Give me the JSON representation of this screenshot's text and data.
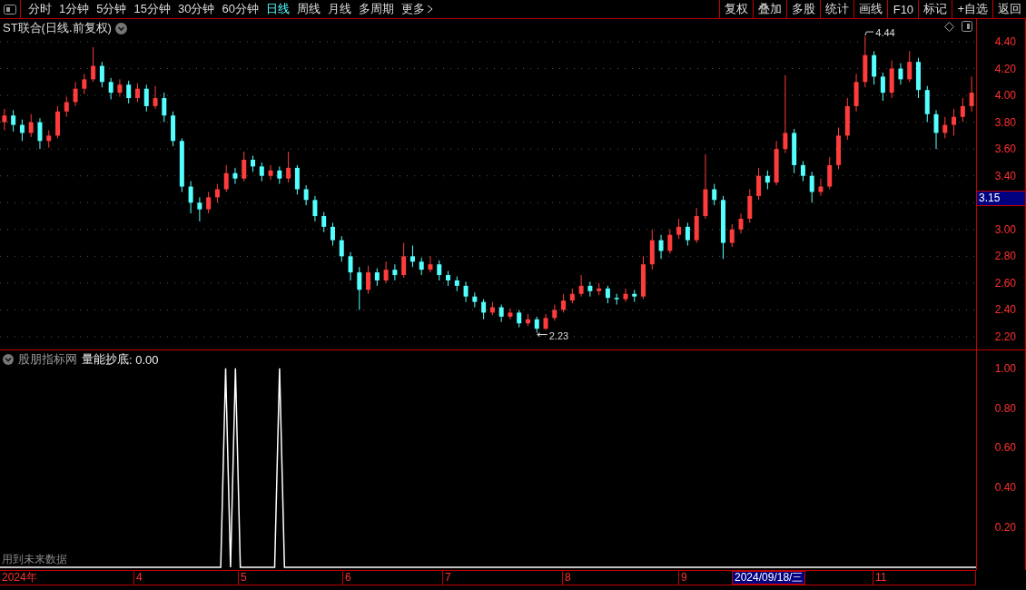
{
  "toolbar": {
    "periods": [
      {
        "label": "分时",
        "selected": false
      },
      {
        "label": "1分钟",
        "selected": false
      },
      {
        "label": "5分钟",
        "selected": false
      },
      {
        "label": "15分钟",
        "selected": false
      },
      {
        "label": "30分钟",
        "selected": false
      },
      {
        "label": "60分钟",
        "selected": false
      },
      {
        "label": "日线",
        "selected": true
      },
      {
        "label": "周线",
        "selected": false
      },
      {
        "label": "月线",
        "selected": false
      },
      {
        "label": "多周期",
        "selected": false
      },
      {
        "label": "更多",
        "selected": false
      }
    ],
    "buttons": [
      "复权",
      "叠加",
      "多股",
      "统计",
      "画线",
      "F10",
      "标记",
      "+自选",
      "返回"
    ]
  },
  "price_chart": {
    "title": "ST联合(日线.前复权)",
    "current_price": "3.15",
    "markers": [
      {
        "kind": "high",
        "label": "4.44"
      },
      {
        "kind": "low",
        "label": "2.23"
      }
    ],
    "chart_data": {
      "type": "candlestick",
      "grid": true,
      "ylim": [
        2.2,
        4.4
      ],
      "yticks": [
        {
          "value": 4.4,
          "label": "4.40"
        },
        {
          "value": 4.2,
          "label": "4.20"
        },
        {
          "value": 4.0,
          "label": "4.00"
        },
        {
          "value": 3.8,
          "label": "3.80"
        },
        {
          "value": 3.6,
          "label": "3.60"
        },
        {
          "value": 3.4,
          "label": "3.40"
        },
        {
          "value": 3.0,
          "label": "3.00"
        },
        {
          "value": 2.8,
          "label": "2.80"
        },
        {
          "value": 2.6,
          "label": "2.60"
        },
        {
          "value": 2.4,
          "label": "2.40"
        },
        {
          "value": 2.2,
          "label": "2.20"
        }
      ],
      "categories": [
        null,
        null,
        null,
        null,
        null,
        null,
        null,
        null,
        null,
        null,
        null,
        null,
        null,
        null,
        null,
        null,
        null,
        null,
        null,
        null,
        null,
        null,
        null,
        null,
        null,
        null,
        null,
        null,
        null,
        null,
        null,
        null,
        null,
        null,
        null,
        null,
        null,
        null,
        null,
        null,
        null,
        null,
        null,
        null,
        null,
        null,
        null,
        null,
        null,
        null,
        null,
        null,
        null,
        null,
        null,
        null,
        null,
        null,
        null,
        null,
        null,
        null,
        null,
        null,
        null,
        null,
        null,
        null,
        null,
        null,
        null,
        null,
        null,
        null,
        null,
        null,
        null,
        null,
        null,
        null,
        null,
        null,
        null,
        null,
        null,
        null,
        null,
        null,
        null,
        null,
        null,
        null,
        null,
        null,
        null,
        null,
        null,
        null,
        null,
        null,
        null,
        null,
        null,
        null,
        null,
        null,
        null,
        null,
        null,
        null
      ],
      "ohlc": [
        [
          3.8,
          3.9,
          3.74,
          3.85
        ],
        [
          3.85,
          3.89,
          3.73,
          3.78
        ],
        [
          3.78,
          3.82,
          3.66,
          3.72
        ],
        [
          3.72,
          3.86,
          3.69,
          3.8
        ],
        [
          3.8,
          3.83,
          3.6,
          3.66
        ],
        [
          3.66,
          3.74,
          3.61,
          3.7
        ],
        [
          3.7,
          3.92,
          3.68,
          3.88
        ],
        [
          3.88,
          3.99,
          3.84,
          3.95
        ],
        [
          3.95,
          4.1,
          3.92,
          4.05
        ],
        [
          4.05,
          4.16,
          4.01,
          4.12
        ],
        [
          4.12,
          4.36,
          4.1,
          4.22
        ],
        [
          4.22,
          4.25,
          4.06,
          4.1
        ],
        [
          4.1,
          4.13,
          3.97,
          4.02
        ],
        [
          4.02,
          4.12,
          3.99,
          4.08
        ],
        [
          4.08,
          4.11,
          3.94,
          3.98
        ],
        [
          3.98,
          4.09,
          3.95,
          4.05
        ],
        [
          4.05,
          4.08,
          3.88,
          3.92
        ],
        [
          3.92,
          4.07,
          3.9,
          3.98
        ],
        [
          3.98,
          4.02,
          3.8,
          3.85
        ],
        [
          3.85,
          3.88,
          3.62,
          3.66
        ],
        [
          3.66,
          3.68,
          3.28,
          3.32
        ],
        [
          3.32,
          3.36,
          3.12,
          3.2
        ],
        [
          3.2,
          3.24,
          3.06,
          3.15
        ],
        [
          3.15,
          3.28,
          3.12,
          3.24
        ],
        [
          3.24,
          3.34,
          3.2,
          3.3
        ],
        [
          3.3,
          3.48,
          3.28,
          3.42
        ],
        [
          3.42,
          3.46,
          3.34,
          3.38
        ],
        [
          3.38,
          3.58,
          3.36,
          3.52
        ],
        [
          3.52,
          3.55,
          3.43,
          3.47
        ],
        [
          3.47,
          3.5,
          3.36,
          3.4
        ],
        [
          3.4,
          3.48,
          3.37,
          3.44
        ],
        [
          3.44,
          3.47,
          3.34,
          3.38
        ],
        [
          3.38,
          3.58,
          3.35,
          3.46
        ],
        [
          3.46,
          3.48,
          3.26,
          3.3
        ],
        [
          3.3,
          3.33,
          3.18,
          3.22
        ],
        [
          3.22,
          3.25,
          3.06,
          3.1
        ],
        [
          3.1,
          3.13,
          2.98,
          3.02
        ],
        [
          3.02,
          3.05,
          2.88,
          2.92
        ],
        [
          2.92,
          2.95,
          2.76,
          2.8
        ],
        [
          2.8,
          2.83,
          2.62,
          2.68
        ],
        [
          2.68,
          2.72,
          2.4,
          2.55
        ],
        [
          2.55,
          2.73,
          2.52,
          2.68
        ],
        [
          2.68,
          2.71,
          2.58,
          2.62
        ],
        [
          2.62,
          2.76,
          2.6,
          2.7
        ],
        [
          2.7,
          2.74,
          2.62,
          2.66
        ],
        [
          2.66,
          2.9,
          2.64,
          2.8
        ],
        [
          2.8,
          2.88,
          2.72,
          2.76
        ],
        [
          2.76,
          2.79,
          2.66,
          2.7
        ],
        [
          2.7,
          2.8,
          2.68,
          2.74
        ],
        [
          2.74,
          2.77,
          2.62,
          2.66
        ],
        [
          2.66,
          2.69,
          2.58,
          2.62
        ],
        [
          2.62,
          2.65,
          2.54,
          2.58
        ],
        [
          2.58,
          2.61,
          2.46,
          2.5
        ],
        [
          2.5,
          2.53,
          2.42,
          2.46
        ],
        [
          2.46,
          2.48,
          2.33,
          2.38
        ],
        [
          2.38,
          2.46,
          2.36,
          2.42
        ],
        [
          2.42,
          2.44,
          2.31,
          2.35
        ],
        [
          2.35,
          2.41,
          2.33,
          2.38
        ],
        [
          2.38,
          2.4,
          2.27,
          2.3
        ],
        [
          2.3,
          2.37,
          2.28,
          2.33
        ],
        [
          2.33,
          2.35,
          2.23,
          2.26
        ],
        [
          2.26,
          2.37,
          2.25,
          2.34
        ],
        [
          2.34,
          2.44,
          2.32,
          2.4
        ],
        [
          2.4,
          2.52,
          2.38,
          2.47
        ],
        [
          2.47,
          2.56,
          2.45,
          2.52
        ],
        [
          2.52,
          2.66,
          2.5,
          2.58
        ],
        [
          2.58,
          2.61,
          2.5,
          2.54
        ],
        [
          2.54,
          2.6,
          2.51,
          2.56
        ],
        [
          2.56,
          2.58,
          2.45,
          2.49
        ],
        [
          2.49,
          2.52,
          2.44,
          2.48
        ],
        [
          2.48,
          2.56,
          2.46,
          2.52
        ],
        [
          2.52,
          2.55,
          2.46,
          2.5
        ],
        [
          2.5,
          2.8,
          2.48,
          2.74
        ],
        [
          2.74,
          3.0,
          2.7,
          2.92
        ],
        [
          2.92,
          2.96,
          2.78,
          2.84
        ],
        [
          2.84,
          3.0,
          2.82,
          2.96
        ],
        [
          2.96,
          3.08,
          2.93,
          3.02
        ],
        [
          3.02,
          3.05,
          2.88,
          2.92
        ],
        [
          2.92,
          3.16,
          2.9,
          3.1
        ],
        [
          3.1,
          3.56,
          3.08,
          3.3
        ],
        [
          3.3,
          3.34,
          3.18,
          3.22
        ],
        [
          3.22,
          3.25,
          2.78,
          2.9
        ],
        [
          2.9,
          3.04,
          2.87,
          3.0
        ],
        [
          3.0,
          3.12,
          2.97,
          3.08
        ],
        [
          3.08,
          3.3,
          3.05,
          3.25
        ],
        [
          3.25,
          3.46,
          3.22,
          3.4
        ],
        [
          3.4,
          3.44,
          3.3,
          3.35
        ],
        [
          3.35,
          3.66,
          3.33,
          3.6
        ],
        [
          3.6,
          4.15,
          3.57,
          3.72
        ],
        [
          3.72,
          3.75,
          3.42,
          3.48
        ],
        [
          3.48,
          3.51,
          3.36,
          3.4
        ],
        [
          3.4,
          3.43,
          3.2,
          3.28
        ],
        [
          3.28,
          3.38,
          3.25,
          3.32
        ],
        [
          3.32,
          3.54,
          3.3,
          3.48
        ],
        [
          3.48,
          3.76,
          3.45,
          3.7
        ],
        [
          3.7,
          3.98,
          3.67,
          3.92
        ],
        [
          3.92,
          4.16,
          3.88,
          4.1
        ],
        [
          4.1,
          4.44,
          4.06,
          4.3
        ],
        [
          4.3,
          4.33,
          4.08,
          4.14
        ],
        [
          4.14,
          4.17,
          3.96,
          4.02
        ],
        [
          4.02,
          4.26,
          3.98,
          4.2
        ],
        [
          4.2,
          4.24,
          4.08,
          4.12
        ],
        [
          4.12,
          4.33,
          4.1,
          4.25
        ],
        [
          4.25,
          4.28,
          3.98,
          4.04
        ],
        [
          4.04,
          4.07,
          3.8,
          3.86
        ],
        [
          3.86,
          3.89,
          3.6,
          3.72
        ],
        [
          3.72,
          3.84,
          3.68,
          3.78
        ],
        [
          3.78,
          3.9,
          3.7,
          3.84
        ],
        [
          3.84,
          3.98,
          3.8,
          3.92
        ],
        [
          3.92,
          4.14,
          3.88,
          4.02
        ]
      ]
    }
  },
  "indicator": {
    "source": "股朋指标网",
    "reading": ": 0.00",
    "note": "用到未来数据",
    "chart_data": {
      "type": "line",
      "ylim": [
        0,
        1.09
      ],
      "yticks": [
        {
          "value": 1,
          "label": "1.00"
        },
        {
          "value": 0.8,
          "label": "0.80"
        },
        {
          "value": 0.6,
          "label": "0.60"
        },
        {
          "value": 0.4,
          "label": "0.40"
        },
        {
          "value": 0.2,
          "label": "0.20"
        }
      ],
      "categories": [
        null,
        null,
        null,
        null,
        null,
        null,
        null,
        null,
        null,
        null,
        null,
        null,
        null,
        null,
        null,
        null,
        null,
        null,
        null,
        null,
        null,
        null,
        null,
        null,
        null,
        null,
        null,
        null,
        null,
        null,
        null,
        null,
        null,
        null,
        null,
        null,
        null,
        null,
        null,
        null,
        null,
        null,
        null,
        null,
        null,
        null,
        null,
        null,
        null,
        null,
        null,
        null,
        null,
        null,
        null,
        null,
        null,
        null,
        null,
        null,
        null,
        null,
        null,
        null,
        null,
        null,
        null,
        null,
        null,
        null,
        null,
        null,
        null,
        null,
        null,
        null,
        null,
        null,
        null,
        null,
        null,
        null,
        null,
        null,
        null,
        null,
        null,
        null,
        null,
        null,
        null,
        null,
        null,
        null,
        null,
        null,
        null,
        null,
        null,
        null,
        null,
        null,
        null,
        null,
        null,
        null,
        null,
        null,
        null,
        null,
        null,
        null,
        null,
        null,
        null,
        null,
        null,
        null,
        null,
        null,
        null,
        null,
        null,
        null,
        null,
        null,
        null,
        null,
        null,
        null,
        null,
        null,
        null,
        null,
        null,
        null,
        null,
        null,
        null,
        null,
        null,
        null,
        null,
        null,
        null,
        null,
        null,
        null,
        null,
        null,
        null,
        null,
        null,
        null,
        null,
        null,
        null,
        null,
        null,
        null,
        null,
        null,
        null,
        null,
        null,
        null,
        null,
        null,
        null,
        null,
        null,
        null,
        null,
        null,
        null,
        null,
        null,
        null,
        null,
        null,
        null,
        null,
        null,
        null,
        null,
        null,
        null,
        null,
        null,
        null,
        null,
        null,
        null,
        null,
        null,
        null,
        null,
        null,
        null,
        null
      ],
      "series": [
        {
          "name": "量能抄底",
          "color": "#ffffff",
          "values": [
            0,
            0,
            0,
            0,
            0,
            0,
            0,
            0,
            0,
            0,
            0,
            0,
            0,
            0,
            0,
            0,
            0,
            0,
            0,
            0,
            0,
            0,
            0,
            0,
            0,
            0,
            0,
            0,
            0,
            0,
            0,
            0,
            0,
            0,
            0,
            0,
            0,
            0,
            0,
            0,
            0,
            0,
            0,
            0,
            0,
            0,
            1,
            0,
            1,
            0,
            0,
            0,
            0,
            0,
            0,
            0,
            0,
            1,
            0,
            0,
            0,
            0,
            0,
            0,
            0,
            0,
            0,
            0,
            0,
            0,
            0,
            0,
            0,
            0,
            0,
            0,
            0,
            0,
            0,
            0,
            0,
            0,
            0,
            0,
            0,
            0,
            0,
            0,
            0,
            0,
            0,
            0,
            0,
            0,
            0,
            0,
            0,
            0,
            0,
            0,
            0,
            0,
            0,
            0,
            0,
            0,
            0,
            0,
            0,
            0,
            0,
            0,
            0,
            0,
            0,
            0,
            0,
            0,
            0,
            0,
            0,
            0,
            0,
            0,
            0,
            0,
            0,
            0,
            0,
            0,
            0,
            0,
            0,
            0,
            0,
            0,
            0,
            0,
            0,
            0,
            0,
            0,
            0,
            0,
            0,
            0,
            0,
            0,
            0,
            0,
            0,
            0,
            0,
            0,
            0,
            0,
            0,
            0,
            0,
            0,
            0,
            0,
            0,
            0,
            0,
            0,
            0,
            0,
            0,
            0,
            0,
            0,
            0,
            0,
            0,
            0,
            0,
            0,
            0,
            0,
            0,
            0,
            0,
            0,
            0,
            0,
            0,
            0,
            0,
            0,
            0,
            0,
            0,
            0,
            0,
            0,
            0,
            0,
            0,
            0
          ]
        }
      ]
    }
  },
  "time_axis": {
    "labels": [
      "2024年",
      "4",
      "5",
      "6",
      "7",
      "8",
      "9",
      "11"
    ],
    "cursor_date": "2024/09/18/三"
  }
}
